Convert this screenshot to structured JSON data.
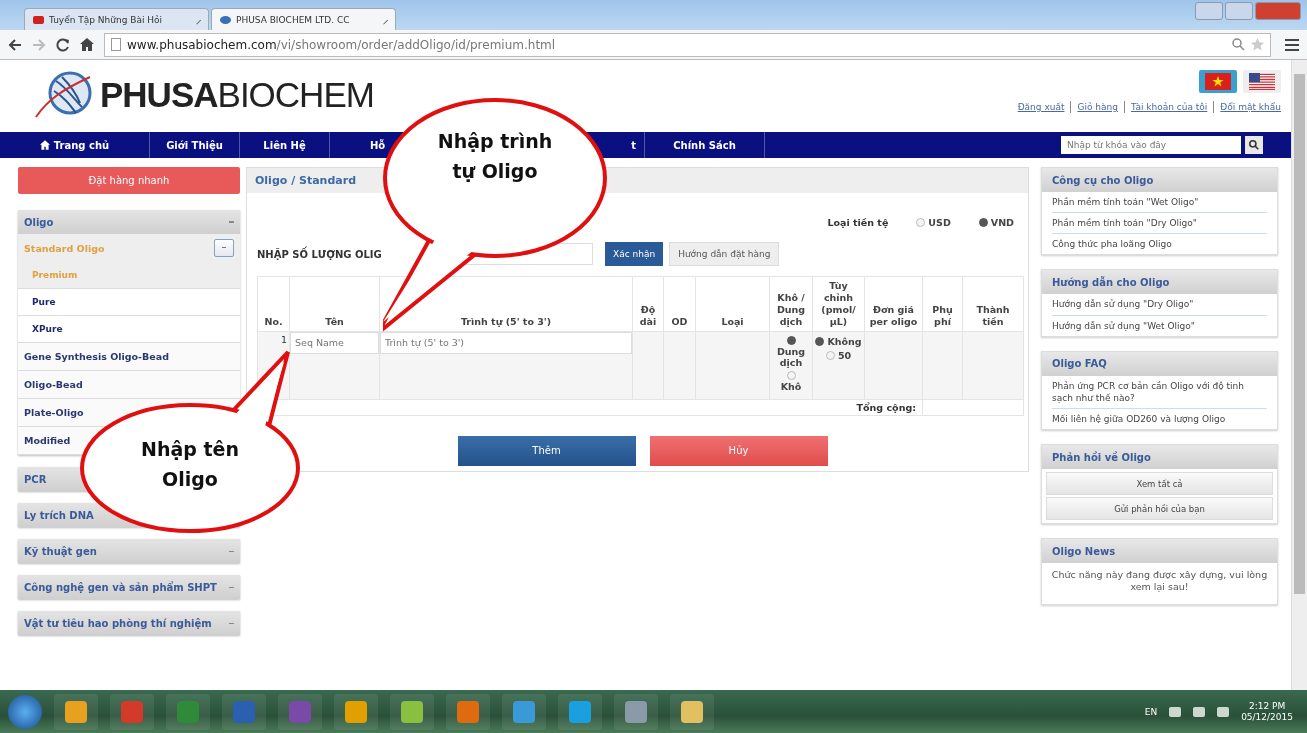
{
  "browser": {
    "tabs": [
      {
        "title": "Tuyển Tập Những Bài Hỏi",
        "selected": false
      },
      {
        "title": "PHUSA BIOCHEM LTD. CC",
        "selected": true
      }
    ],
    "url_host": "www.phusabiochem.com",
    "url_path": "/vi/showroom/order/addOligo/id/premium.html"
  },
  "header": {
    "brand_bold": "PHUSA",
    "brand_light": "BIOCHEM",
    "languages": [
      {
        "selected": true,
        "kind": "vn"
      },
      {
        "selected": false,
        "kind": "us"
      }
    ],
    "user_links": [
      "Đăng xuất",
      "Giỏ hàng",
      "Tài khoản của tôi",
      "Đổi mật khẩu"
    ]
  },
  "nav": {
    "items": [
      {
        "label": "Trang chủ",
        "kind": "home"
      },
      {
        "label": "Giới Thiệu",
        "kind": "link"
      },
      {
        "label": "Liên Hệ",
        "kind": "link"
      },
      {
        "label": "Hỗ",
        "kind": "link"
      },
      {
        "label": "t",
        "kind": "link"
      },
      {
        "label": "Chính Sách",
        "kind": "link"
      }
    ],
    "search_placeholder": "Nhập từ khóa vào đây"
  },
  "sidebar": {
    "quick_order": "Đặt hàng nhanh",
    "menu": [
      {
        "label": "Oligo",
        "expanded": true,
        "children": [
          {
            "label": "Standard Oligo",
            "expanded": true,
            "selected": true,
            "children": [
              {
                "label": "Premium",
                "selected": true
              },
              {
                "label": "Pure",
                "selected": false
              },
              {
                "label": "XPure",
                "selected": false
              }
            ]
          },
          {
            "label": "Gene Synthesis Oligo-Bead",
            "selected": false
          },
          {
            "label": "Oligo-Bead",
            "selected": false
          },
          {
            "label": "Plate-Oligo",
            "selected": false
          },
          {
            "label": "Modified",
            "selected": false
          }
        ]
      },
      {
        "label": "PCR",
        "expanded": false
      },
      {
        "label": "Ly trích DNA",
        "expanded": false
      },
      {
        "label": "Kỹ thuật gen",
        "expanded": false
      },
      {
        "label": "Công nghệ gen và sản phẩm SHPT",
        "expanded": false
      },
      {
        "label": "Vật tư tiêu hao phòng thí nghiệm",
        "expanded": false
      }
    ]
  },
  "main": {
    "breadcrumb": "Oligo / Standard",
    "currency_label": "Loại tiền tệ",
    "currencies": [
      {
        "label": "USD",
        "selected": false
      },
      {
        "label": "VND",
        "selected": true
      }
    ],
    "quantity_label": "NHẬP SỐ LƯỢNG OLIG",
    "confirm_button": "Xác nhận",
    "guide_button": "Hướng dẫn đặt hàng",
    "table": {
      "columns": [
        "No.",
        "Tên",
        "Trình tự (5' to 3')",
        "Độ dài",
        "OD",
        "Loại",
        "Khô / Dung dịch",
        "Tùy chỉnh (pmol/ µL)",
        "Đơn giá per oligo",
        "Phụ phí",
        "Thành tiền"
      ],
      "rows": [
        {
          "no": "1",
          "name_placeholder": "Seq Name",
          "sequence_placeholder": "Trình tự (5' to 3')",
          "form_options": [
            {
              "label": "Dung dịch",
              "selected": true
            },
            {
              "label": "Khô",
              "selected": false
            }
          ],
          "custom_options": [
            {
              "label": "Không",
              "selected": true
            },
            {
              "label": "50",
              "selected": false
            }
          ]
        }
      ],
      "total_label": "Tổng cộng:"
    },
    "add_button": "Thêm",
    "cancel_button": "Hủy"
  },
  "right_panels": [
    {
      "title": "Công cụ cho Oligo",
      "kind": "links",
      "items": [
        "Phần mềm tính toán \"Wet Oligo\"",
        "Phần mềm tính toán \"Dry Oligo\"",
        "Công thức pha loãng Oligo"
      ]
    },
    {
      "title": "Hướng dẫn cho Oligo",
      "kind": "links",
      "items": [
        "Hướng dẫn sử dụng \"Dry Oligo\"",
        "Hướng dẫn sử dụng \"Wet Oligo\""
      ]
    },
    {
      "title": "Oligo FAQ",
      "kind": "links",
      "items": [
        "Phản ứng PCR cơ bản cần Oligo với độ tinh sạch như thế nào?",
        "Mối liên hệ giữa OD260 và lượng Oligo"
      ]
    },
    {
      "title": "Phản hồi về Oligo",
      "kind": "buttons",
      "items": [
        "Xem tất cả",
        "Gửi phản hồi của bạn"
      ]
    },
    {
      "title": "Oligo News",
      "kind": "text",
      "items": [
        "Chức năng này đang được xây dựng, vui lòng xem lại sau!"
      ]
    }
  ],
  "callouts": [
    {
      "text": "Nhập trình tự Oligo"
    },
    {
      "text": "Nhập tên Oligo"
    }
  ],
  "taskbar": {
    "language": "EN",
    "time": "2:12 PM",
    "date": "05/12/2015"
  }
}
